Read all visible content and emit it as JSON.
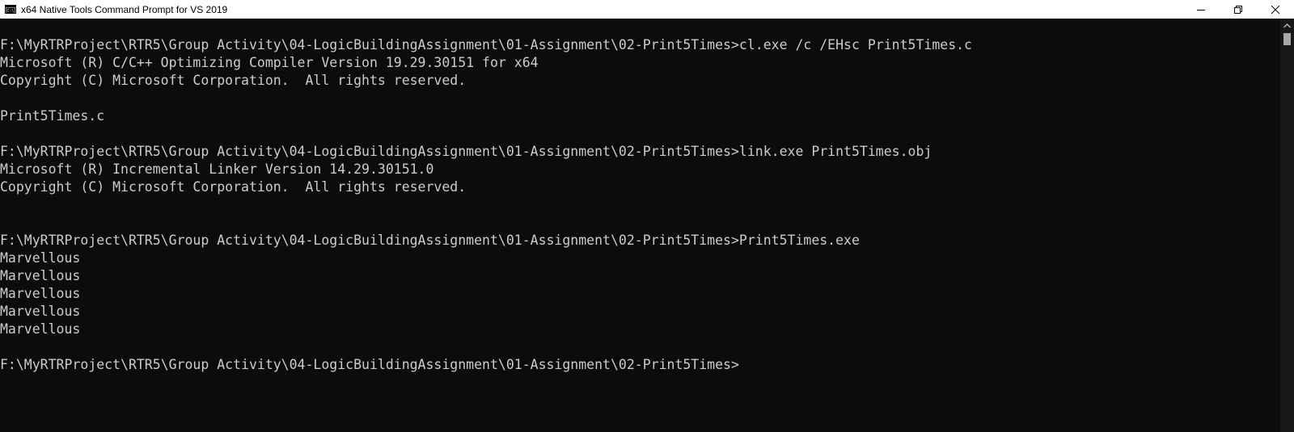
{
  "window": {
    "title": "x64 Native Tools Command Prompt for VS 2019",
    "icon": "cmd-icon",
    "controls": [
      "minimize-icon",
      "restore-icon",
      "close-icon"
    ]
  },
  "console": {
    "lines": [
      "",
      "F:\\MyRTRProject\\RTR5\\Group Activity\\04-LogicBuildingAssignment\\01-Assignment\\02-Print5Times>cl.exe /c /EHsc Print5Times.c",
      "Microsoft (R) C/C++ Optimizing Compiler Version 19.29.30151 for x64",
      "Copyright (C) Microsoft Corporation.  All rights reserved.",
      "",
      "Print5Times.c",
      "",
      "F:\\MyRTRProject\\RTR5\\Group Activity\\04-LogicBuildingAssignment\\01-Assignment\\02-Print5Times>link.exe Print5Times.obj",
      "Microsoft (R) Incremental Linker Version 14.29.30151.0",
      "Copyright (C) Microsoft Corporation.  All rights reserved.",
      "",
      "",
      "F:\\MyRTRProject\\RTR5\\Group Activity\\04-LogicBuildingAssignment\\01-Assignment\\02-Print5Times>Print5Times.exe",
      "Marvellous",
      "Marvellous",
      "Marvellous",
      "Marvellous",
      "Marvellous",
      "",
      "F:\\MyRTRProject\\RTR5\\Group Activity\\04-LogicBuildingAssignment\\01-Assignment\\02-Print5Times>"
    ]
  },
  "colors": {
    "background": "#0c0c0c",
    "text": "#cccccc",
    "titlebar": "#ffffff"
  }
}
